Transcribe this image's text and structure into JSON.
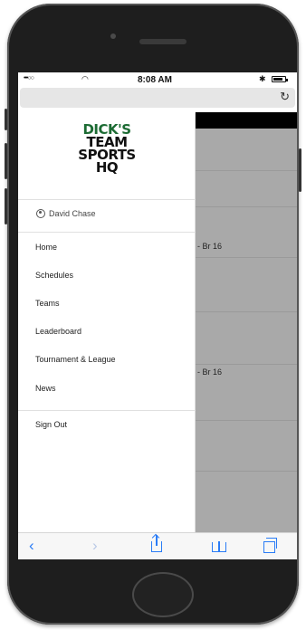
{
  "status_bar": {
    "signal": "•••○○",
    "wifi_icon": "wifi-icon",
    "time": "8:08 AM",
    "bluetooth_icon": "bluetooth-icon",
    "battery_icon": "battery-icon"
  },
  "address_bar": {
    "reload_icon": "reload-icon"
  },
  "logo": {
    "lines": [
      "DICK'S",
      "TEAM",
      "SPORTS",
      "HQ"
    ]
  },
  "user": {
    "name": "David Chase"
  },
  "menu": {
    "items": [
      {
        "label": "Home"
      },
      {
        "label": "Schedules"
      },
      {
        "label": "Teams"
      },
      {
        "label": "Leaderboard"
      },
      {
        "label": "Tournament & League"
      },
      {
        "label": "News"
      }
    ],
    "sign_out": "Sign Out"
  },
  "background": {
    "snippets": [
      "- Br 16",
      "- Br 16"
    ]
  },
  "toolbar": {
    "back_icon": "back-chevron-icon",
    "forward_icon": "forward-chevron-icon",
    "share_icon": "share-icon",
    "bookmarks_icon": "bookmarks-icon",
    "tabs_icon": "tabs-icon"
  },
  "colors": {
    "accent": "#2a7cf6",
    "logo_green": "#1c6b33",
    "overlay_gray": "#a9a9a9"
  }
}
